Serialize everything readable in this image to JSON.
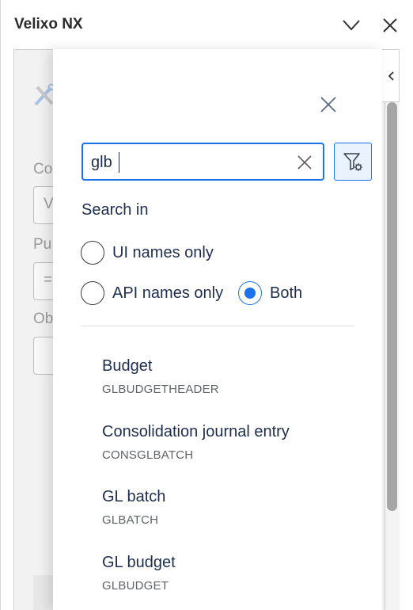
{
  "window": {
    "title": "Velixo NX",
    "collapse_label": "",
    "close_label": ""
  },
  "underlying": {
    "labels": [
      "Co",
      "Pu",
      "Ob"
    ],
    "field_values": [
      "V",
      "="
    ]
  },
  "search": {
    "value": "glb",
    "placeholder": ""
  },
  "search_in": {
    "heading": "Search in",
    "options": [
      {
        "label": "UI names only",
        "checked": false
      },
      {
        "label": "API names only",
        "checked": false
      },
      {
        "label": "Both",
        "checked": true
      }
    ]
  },
  "results": [
    {
      "title": "Budget",
      "api_name": "GLBUDGETHEADER"
    },
    {
      "title": "Consolidation journal entry",
      "api_name": "CONSGLBATCH"
    },
    {
      "title": "GL batch",
      "api_name": "GLBATCH"
    },
    {
      "title": "GL budget",
      "api_name": "GLBUDGET"
    }
  ],
  "icons": {
    "header_chevron": "chevron-down-icon",
    "header_close": "close-icon",
    "collapse": "chevron-left-icon",
    "overlay_close": "close-icon",
    "clear": "clear-icon",
    "filter": "filter-settings-icon",
    "tools": "tools-icon"
  },
  "colors": {
    "accent": "#1a73e8",
    "text_primary": "#1f2d4d",
    "text_secondary": "#5f6368"
  }
}
